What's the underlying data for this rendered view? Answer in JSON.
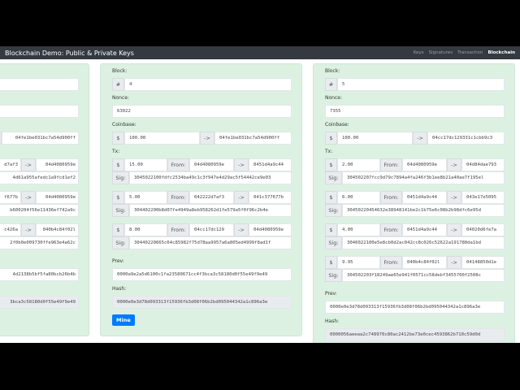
{
  "navbar": {
    "title": "Blockchain Demo: Public & Private Keys",
    "links": [
      "Keys",
      "Signatures",
      "Transaction",
      "Blockchain"
    ],
    "active": "Blockchain"
  },
  "labels": {
    "block": "Block:",
    "nonce": "Nonce:",
    "coinbase": "Coinbase:",
    "tx": "Tx:",
    "prev": "Prev:",
    "hash": "Hash:",
    "hash_sign": "#",
    "dollar": "$",
    "arrow": "->",
    "from": "From:",
    "sig": "Sig:",
    "mine": "Mine"
  },
  "blocks": [
    {
      "block": "",
      "nonce": "",
      "coinbase": {
        "amount": "",
        "to": "04fe1be031bc7a54d900ff"
      },
      "txs": [
        {
          "amount": "",
          "from": "d7af3",
          "to": "04d4080959e",
          "sig": "4d61a955afedc1a9fcd1ef2"
        },
        {
          "amount": "",
          "from": "f677b",
          "to": "04d4080959e",
          "sig": "b600204f56e11436ef742a9c"
        },
        {
          "amount": "",
          "from": "c426a",
          "to": "040b4c84f02l",
          "sig": "2f0b0e009730ffe963e4a62c"
        }
      ],
      "prev": "4d2138b5bf5fa80bcb26b4b",
      "hash": "3bca3c58180d0f55e49f9e49"
    },
    {
      "block": "4",
      "nonce": "63022",
      "coinbase": {
        "amount": "100.00",
        "to": "04fe1be031bc7a54d900ff"
      },
      "txs": [
        {
          "amount": "15.00",
          "from": "04d4080959e",
          "to": "0451d4a9c44",
          "sig": "3045022100fdfc2534ba49c1c3f947e4d29ac5f54442ce9e03"
        },
        {
          "amount": "5.00",
          "from": "042222d7af3",
          "to": "041c377677b",
          "sig": "304402200b8d07fe4949a8eb958262d1fe579a5f0f96c2b4e"
        },
        {
          "amount": "8.00",
          "from": "04cc17dc129",
          "to": "04d4080959e",
          "sig": "30440220665c64c85982f75d78aa9957a6a805ed4999f8ad1f"
        }
      ],
      "prev": "0000a9e2a5d6100c1fa23580671cc4f3bca3c58180d0f55e49f9e49",
      "hash": "0000e0e3d78d093313f15936fb3d08f06b2bd095044342a1c896a3e"
    },
    {
      "block": "5",
      "nonce": "7355",
      "coinbase": {
        "amount": "100.00",
        "to": "04cc17dc129331c1cbb9c3"
      },
      "txs": [
        {
          "amount": "2.00",
          "from": "04d4080959e",
          "to": "04d84dae793",
          "sig": "304502207fcc9d79c7894a4fa246f3b1ee8b21a40ae7f195el"
        },
        {
          "amount": "6.00",
          "from": "0451d4a9c44",
          "to": "043e17e5095",
          "sig": "30450220454632e38948141be2c1b75e6c08b2b98dfc6e95d"
        },
        {
          "amount": "4.00",
          "from": "0451d4a9c44",
          "to": "04020d6fe7a",
          "sig": "3046022100e5e8cb0d2ac042cc8c026c52622a191780da1bd"
        },
        {
          "amount": "9.95",
          "from": "040b4c84f02l",
          "to": "04148850d1e",
          "sig": "304502203f18249ae65e941f0571cc58debf3455700f2508c"
        }
      ],
      "prev": "0000e0e3d78d093313f15936fb3d08f06b2bd095044342a1c896a3e",
      "hash": "0000056aeeaa2c748970c80ac2412be73e0cec4593862b710c59d0d"
    }
  ]
}
